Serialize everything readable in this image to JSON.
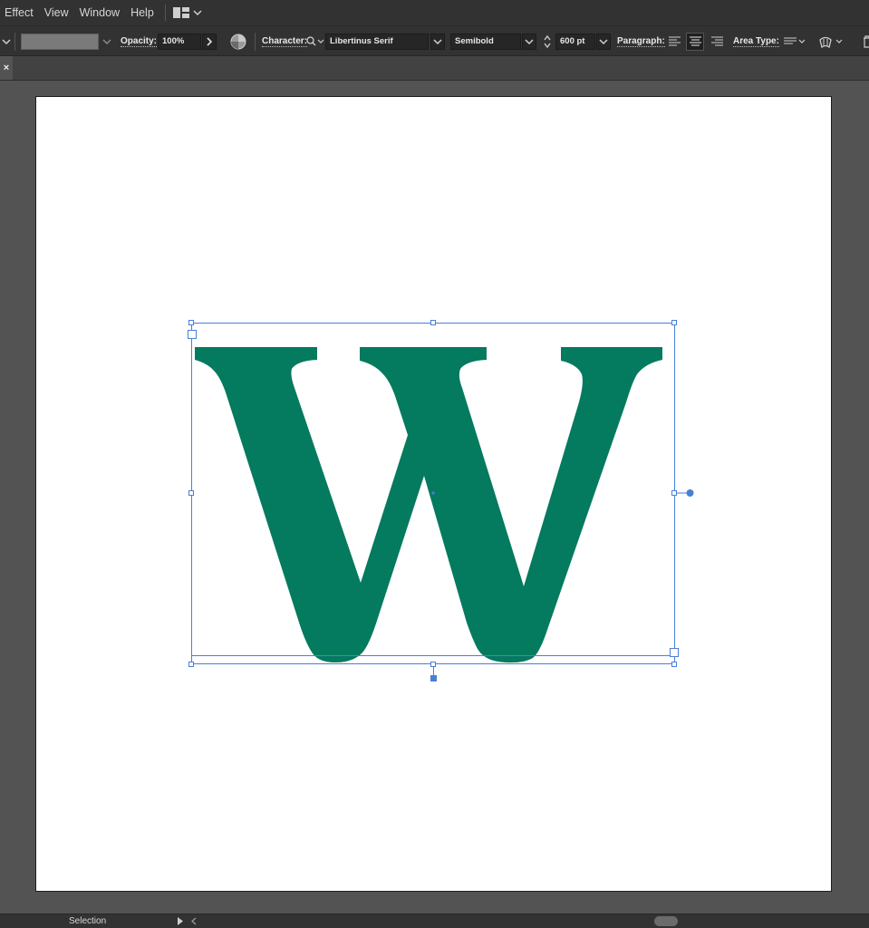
{
  "menu": {
    "items": [
      "Effect",
      "View",
      "Window",
      "Help"
    ]
  },
  "controlbar": {
    "opacity_label": "Opacity:",
    "opacity_value": "100%",
    "character_label": "Character:",
    "font_family": "Libertinus Serif",
    "font_style": "Semibold",
    "font_size": "600 pt",
    "paragraph_label": "Paragraph:",
    "area_type_label": "Area Type:"
  },
  "tab": {
    "close_glyph": "×"
  },
  "canvas": {
    "text_glyph": "W",
    "text_color": "#047A5E",
    "selection_color": "#4A7FD8"
  },
  "status": {
    "tool": "Selection"
  }
}
